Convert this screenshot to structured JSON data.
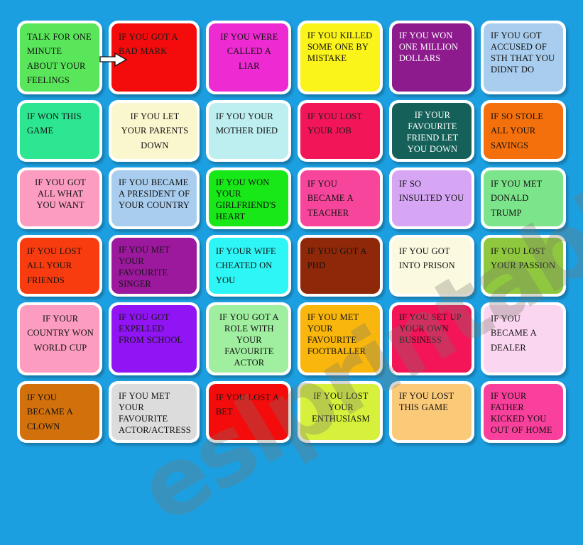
{
  "worksheet": {
    "background_color": "#1c9fe0",
    "card_border_color": "#ffffff",
    "watermark": "eslprintables.com",
    "arrow_icon": "right-arrow-icon",
    "columns": 6,
    "rows": 6
  },
  "cards": [
    {
      "text": "TALK FOR ONE MINUTE ABOUT YOUR FEELINGS",
      "bg": "#5ae65a",
      "fg": "#111111",
      "align": "left",
      "tight": false
    },
    {
      "text": "IF YOU GOT A BAD MARK",
      "bg": "#f40b0b",
      "fg": "#1a1a1a",
      "align": "left",
      "tight": false
    },
    {
      "text": "IF YOU WERE CALLED A LIAR",
      "bg": "#ee2ad2",
      "fg": "#111111",
      "align": "center",
      "tight": false
    },
    {
      "text": "IF YOU KILLED SOME ONE BY MISTAKE",
      "bg": "#fbf41a",
      "fg": "#111111",
      "align": "left",
      "tight": true
    },
    {
      "text": "IF YOU WON ONE MILLION DOLLARS",
      "bg": "#8d1b8d",
      "fg": "#ffffff",
      "align": "left",
      "tight": true
    },
    {
      "text": "IF YOU GOT ACCUSED OF STH THAT YOU DIDNT DO",
      "bg": "#a9cdee",
      "fg": "#111111",
      "align": "left",
      "tight": true
    },
    {
      "text": "IF WON THIS GAME",
      "bg": "#2ce691",
      "fg": "#111111",
      "align": "left",
      "tight": false
    },
    {
      "text": "IF YOU LET YOUR PARENTS DOWN",
      "bg": "#faf6cd",
      "fg": "#111111",
      "align": "center",
      "tight": false
    },
    {
      "text": "IF YOU YOUR MOTHER DIED",
      "bg": "#bdeef0",
      "fg": "#111111",
      "align": "left",
      "tight": false
    },
    {
      "text": "IF YOU LOST YOUR JOB",
      "bg": "#f21558",
      "fg": "#1a1a1a",
      "align": "left",
      "tight": false
    },
    {
      "text": "IF YOUR FAVOURITE FRIEND LET YOU DOWN",
      "bg": "#156159",
      "fg": "#ffffff",
      "align": "center",
      "tight": true
    },
    {
      "text": "IF SO STOLE ALL YOUR SAVINGS",
      "bg": "#f4700c",
      "fg": "#111111",
      "align": "left",
      "tight": false
    },
    {
      "text": "IF YOU GOT ALL  WHAT YOU WANT",
      "bg": "#fc9cc0",
      "fg": "#111111",
      "align": "center",
      "tight": true
    },
    {
      "text": "IF YOU BECAME A PRESIDENT OF YOUR COUNTRY",
      "bg": "#a9cdee",
      "fg": "#111111",
      "align": "left",
      "tight": true
    },
    {
      "text": "IF YOU WON YOUR GIRLFRIEND'S HEART",
      "bg": "#18e818",
      "fg": "#111111",
      "align": "left",
      "tight": true
    },
    {
      "text": "IF YOU BECAME A TEACHER",
      "bg": "#f8459c",
      "fg": "#111111",
      "align": "left",
      "tight": false
    },
    {
      "text": "IF SO INSULTED YOU",
      "bg": "#d6a6f4",
      "fg": "#111111",
      "align": "left",
      "tight": false
    },
    {
      "text": "IF YOU MET DONALD TRUMP",
      "bg": "#7ce48a",
      "fg": "#111111",
      "align": "left",
      "tight": false
    },
    {
      "text": "IF YOU LOST ALL YOUR FRIENDS",
      "bg": "#f83c10",
      "fg": "#111111",
      "align": "left",
      "tight": false
    },
    {
      "text": "IF YOU MET YOUR FAVOURITE SINGER",
      "bg": "#9c189c",
      "fg": "#161616",
      "align": "left",
      "tight": true
    },
    {
      "text": "IF YOUR WIFE CHEATED ON YOU",
      "bg": "#2ef6f6",
      "fg": "#111111",
      "align": "left",
      "tight": false
    },
    {
      "text": "IF YOU GOT A PHD",
      "bg": "#8e2808",
      "fg": "#111111",
      "align": "left",
      "tight": false
    },
    {
      "text": "IF YOU GOT INTO PRISON",
      "bg": "#fbfae0",
      "fg": "#111111",
      "align": "left",
      "tight": false
    },
    {
      "text": "IF YOU LOST YOUR PASSION",
      "bg": "#8fc83e",
      "fg": "#111111",
      "align": "left",
      "tight": false
    },
    {
      "text": "IF YOUR COUNTRY WON WORLD CUP",
      "bg": "#fc9cc0",
      "fg": "#111111",
      "align": "center",
      "tight": false
    },
    {
      "text": "IF YOU GOT EXPELLED FROM SCHOOL",
      "bg": "#9014f4",
      "fg": "#161616",
      "align": "left",
      "tight": true
    },
    {
      "text": "IF YOU GOT A ROLE  WITH YOUR FAVOURITE ACTOR",
      "bg": "#a0eea0",
      "fg": "#111111",
      "align": "center",
      "tight": true
    },
    {
      "text": "IF YOU MET YOUR FAVOURITE FOOTBALLER",
      "bg": "#f9b60c",
      "fg": "#111111",
      "align": "left",
      "tight": true
    },
    {
      "text": "IF YOU SET UP YOUR OWN BUSINESS",
      "bg": "#f41458",
      "fg": "#161616",
      "align": "left",
      "tight": true
    },
    {
      "text": "IF YOU BECAME A DEALER",
      "bg": "#fbd6f0",
      "fg": "#111111",
      "align": "left",
      "tight": false
    },
    {
      "text": "IF YOU BECAME A CLOWN",
      "bg": "#d2700c",
      "fg": "#111111",
      "align": "left",
      "tight": false
    },
    {
      "text": "IF YOU MET YOUR FAVOURITE ACTOR/ACTRESS",
      "bg": "#dcdcdc",
      "fg": "#111111",
      "align": "left",
      "tight": true
    },
    {
      "text": "IF YOU LOST A BET",
      "bg": "#f40b0b",
      "fg": "#161616",
      "align": "left",
      "tight": false
    },
    {
      "text": "IF YOU LOST      YOUR ENTHUSIASM",
      "bg": "#d6f03c",
      "fg": "#111111",
      "align": "center",
      "tight": true
    },
    {
      "text": "IF YOU LOST THIS GAME",
      "bg": "#fbca78",
      "fg": "#111111",
      "align": "left",
      "tight": true
    },
    {
      "text": "IF YOUR FATHER KICKED YOU OUT OF HOME",
      "bg": "#f8409c",
      "fg": "#111111",
      "align": "left",
      "tight": true
    }
  ]
}
